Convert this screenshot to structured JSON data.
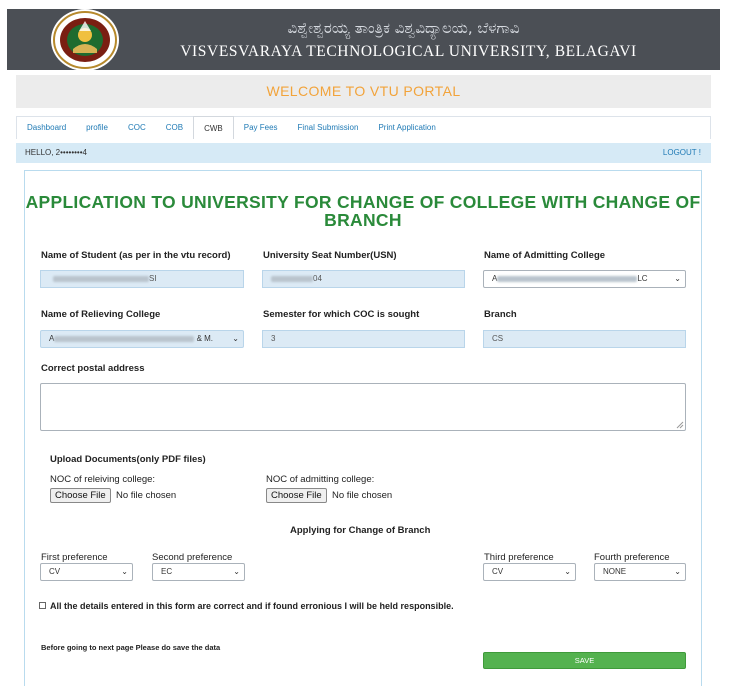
{
  "header": {
    "kannada_title": "ವಿಶ್ವೇಶ್ವರಯ್ಯ ತಾಂತ್ರಿಕ ವಿಶ್ವವಿದ್ಯಾಲಯ, ಬೆಳಗಾವಿ",
    "university_name": "VISVESVARAYA TECHNOLOGICAL UNIVERSITY, BELAGAVI"
  },
  "welcome": "WELCOME TO VTU PORTAL",
  "tabs": [
    {
      "label": "Dashboard"
    },
    {
      "label": "profile"
    },
    {
      "label": "COC"
    },
    {
      "label": "COB"
    },
    {
      "label": "CWB"
    },
    {
      "label": "Pay Fees"
    },
    {
      "label": "Final Submission"
    },
    {
      "label": "Print Application"
    }
  ],
  "active_tab": "CWB",
  "hello_bar": {
    "greeting": "HELLO, 2••••••••4",
    "logout": "LOGOUT !"
  },
  "form": {
    "title": "APPLICATION TO UNIVERSITY FOR CHANGE OF COLLEGE WITH CHANGE OF BRANCH",
    "student_name_label": "Name of Student (as per in the vtu record)",
    "student_name_value_suffix": "SI",
    "usn_label": "University Seat Number(USN)",
    "usn_value_suffix": "04",
    "admitting_college_label": "Name of Admitting College",
    "admitting_college_value_prefix": "A",
    "admitting_college_value_suffix": "LC",
    "relieving_college_label": "Name of Relieving College",
    "relieving_college_value_prefix": "A",
    "relieving_college_value_suffix": "& M.",
    "semester_label": "Semester for which COC is sought",
    "semester_value": "3",
    "branch_label": "Branch",
    "branch_value": "CS",
    "address_label": "Correct postal address",
    "upload_label": "Upload Documents(only PDF files)",
    "noc_relieving_label": "NOC of releiving college:",
    "noc_admitting_label": "NOC of admitting college:",
    "choose_file": "Choose File",
    "no_file": "No file chosen",
    "branch_change_heading": "Applying for Change of Branch",
    "first_pref_label": "First preference",
    "first_pref_value": "CV",
    "second_pref_label": "Second preference",
    "second_pref_value": "EC",
    "third_pref_label": "Third preference",
    "third_pref_value": "CV",
    "fourth_pref_label": "Fourth preference",
    "fourth_pref_value": "NONE",
    "declaration": "All the details entered in this form are correct and if found erronious I will be held responsible.",
    "save_note": "Before going to next page Please do save the data",
    "save_button": "SAVE"
  },
  "colors": {
    "header_bg": "#4b4f55",
    "welcome_text": "#f2a33a",
    "title_green": "#2a8a3a",
    "link_blue": "#1f7ab5",
    "save_green": "#54b24f"
  }
}
